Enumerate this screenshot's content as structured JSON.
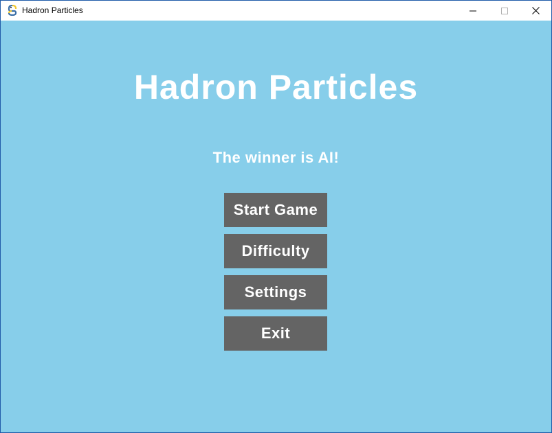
{
  "window": {
    "title": "Hadron Particles",
    "icon": "pygame-snake-icon"
  },
  "game": {
    "title": "Hadron Particles",
    "status": "The winner is AI!"
  },
  "menu": {
    "items": [
      {
        "label": "Start Game"
      },
      {
        "label": "Difficulty"
      },
      {
        "label": "Settings"
      },
      {
        "label": "Exit"
      }
    ]
  },
  "colors": {
    "background": "#87ceea",
    "button": "#646464",
    "text": "#ffffff"
  }
}
